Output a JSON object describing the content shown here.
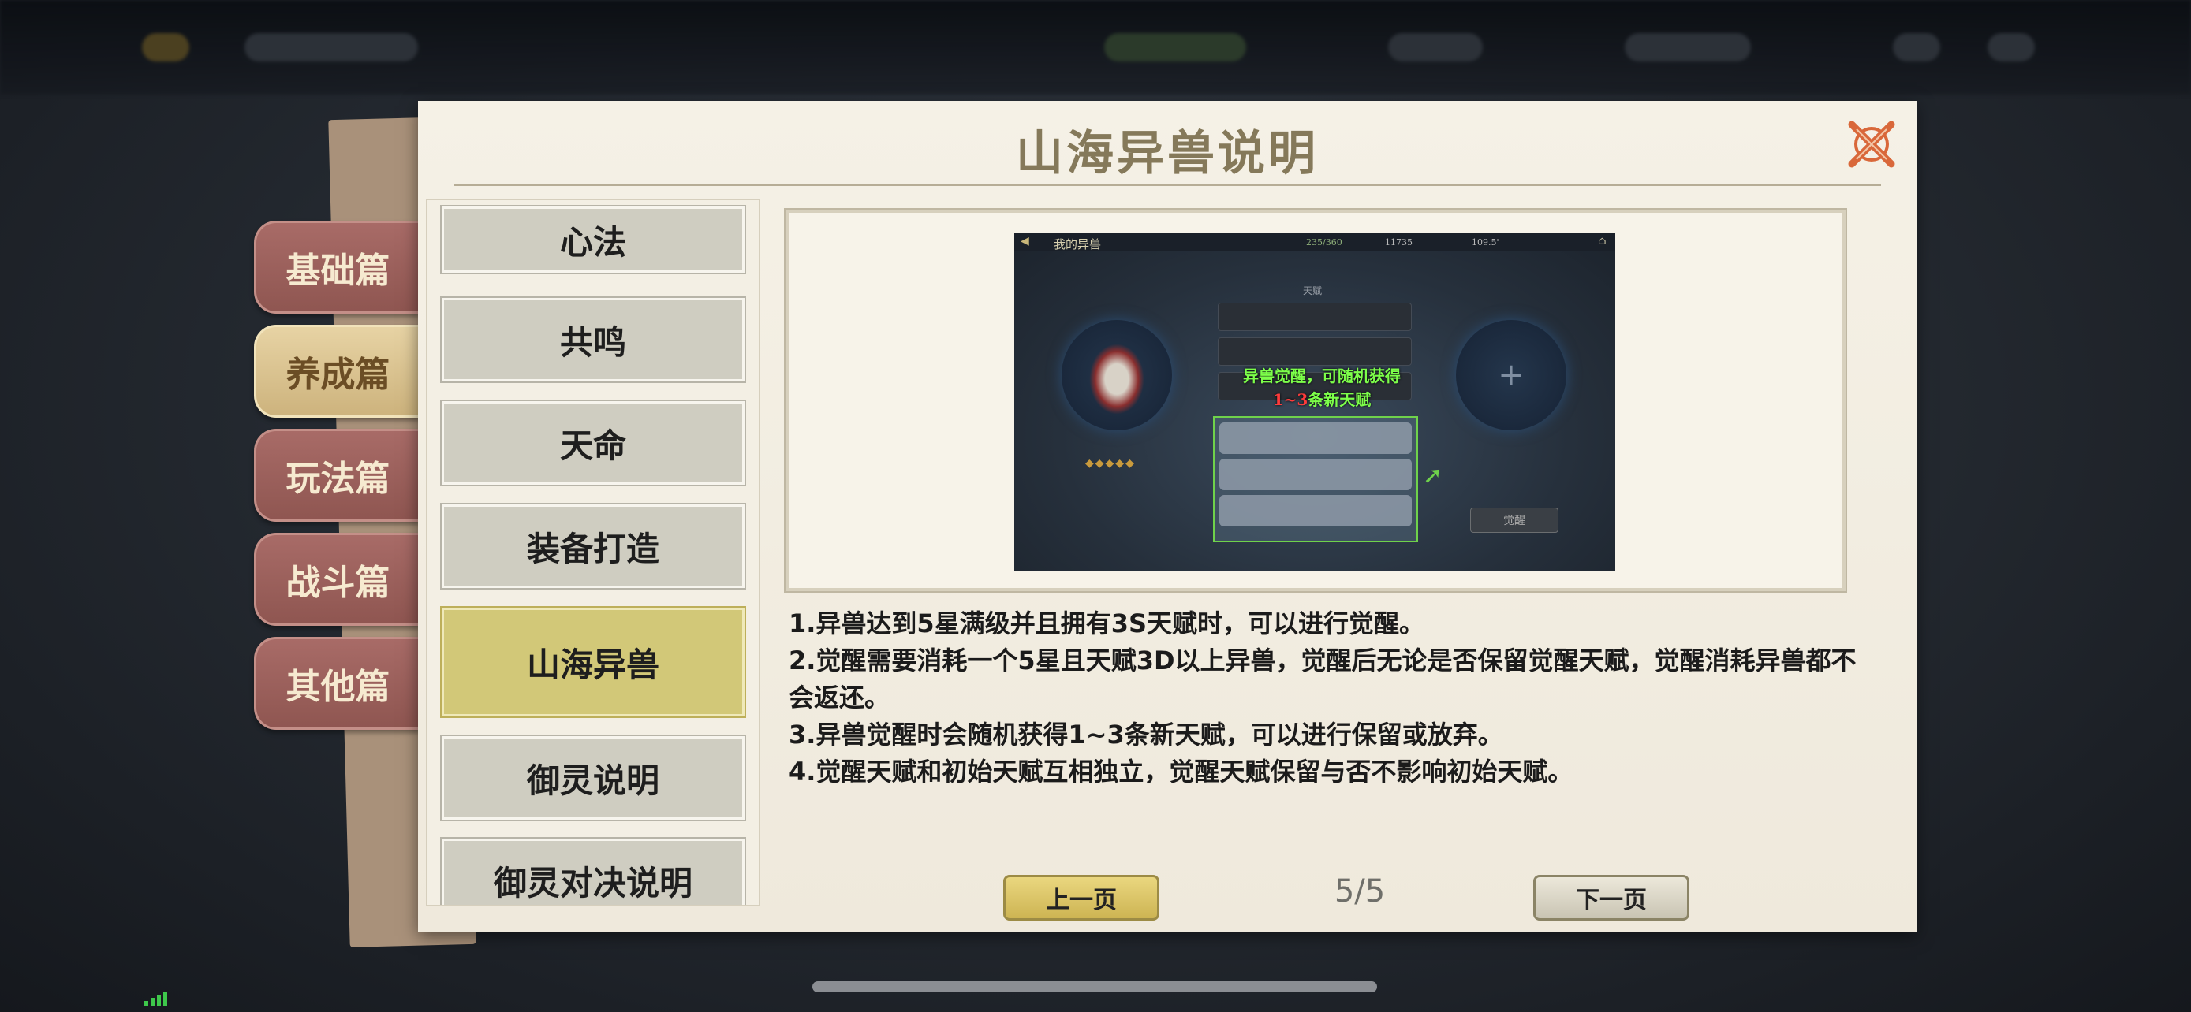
{
  "dialog": {
    "title": "山海异兽说明",
    "close_icon": "close-x-icon"
  },
  "categories": [
    {
      "label": "基础篇",
      "active": false
    },
    {
      "label": "养成篇",
      "active": true
    },
    {
      "label": "玩法篇",
      "active": false
    },
    {
      "label": "战斗篇",
      "active": false
    },
    {
      "label": "其他篇",
      "active": false
    }
  ],
  "topics": [
    {
      "label": "心法",
      "active": false
    },
    {
      "label": "共鸣",
      "active": false
    },
    {
      "label": "天命",
      "active": false
    },
    {
      "label": "装备打造",
      "active": false
    },
    {
      "label": "山海异兽",
      "active": true
    },
    {
      "label": "御灵说明",
      "active": false
    },
    {
      "label": "御灵对决说明",
      "active": false
    }
  ],
  "preview": {
    "header": "我的异兽",
    "stat1": "235/360",
    "stat2": "11735",
    "stat3": "109.5'",
    "section": "天赋",
    "tip_line1": "异兽觉醒，可随机获得",
    "tip_line2": "1~3条新天赋",
    "tip_highlight": "1~3",
    "awaken_button": "觉醒"
  },
  "description": [
    "1.异兽达到5星满级并且拥有3S天赋时，可以进行觉醒。",
    "2.觉醒需要消耗一个5星且天赋3D以上异兽，觉醒后无论是否保留觉醒天赋，觉醒消耗异兽都不会返还。",
    "3.异兽觉醒时会随机获得1~3条新天赋，可以进行保留或放弃。",
    "4.觉醒天赋和初始天赋互相独立，觉醒天赋保留与否不影响初始天赋。"
  ],
  "pagination": {
    "prev_label": "上一页",
    "next_label": "下一页",
    "indicator": "5/5",
    "current": 5,
    "total": 5
  },
  "colors": {
    "accent_active_topic": "#d2c878",
    "category_tab": "#9c615c",
    "close_icon": "#d9683a",
    "tip_green": "#7dff4a",
    "tip_red": "#ff3b3b"
  }
}
